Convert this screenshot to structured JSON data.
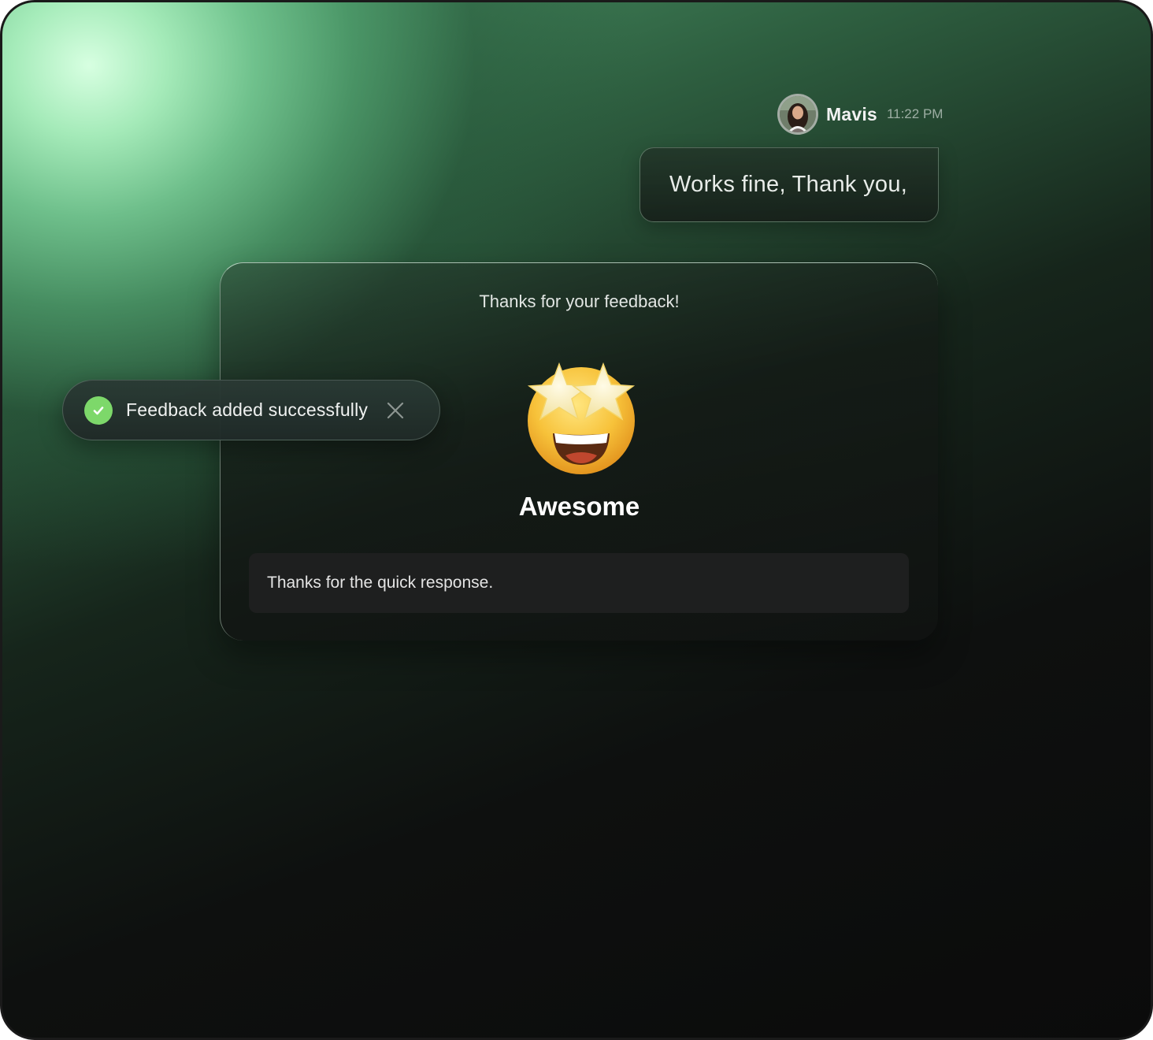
{
  "message": {
    "sender_name": "Mavis",
    "time": "11:22 PM",
    "text": "Works fine, Thank you,"
  },
  "feedback_card": {
    "title": "Thanks for your feedback!",
    "rating_emoji": "star-struck-emoji",
    "rating_label": "Awesome",
    "comment": "Thanks for the quick response."
  },
  "toast": {
    "text": "Feedback added successfully",
    "status_icon": "check-circle-icon",
    "dismiss_icon": "close-icon"
  },
  "colors": {
    "success": "#7dd86a",
    "accent_glow": "#b8f5c8",
    "background": "#0b0b0b"
  }
}
